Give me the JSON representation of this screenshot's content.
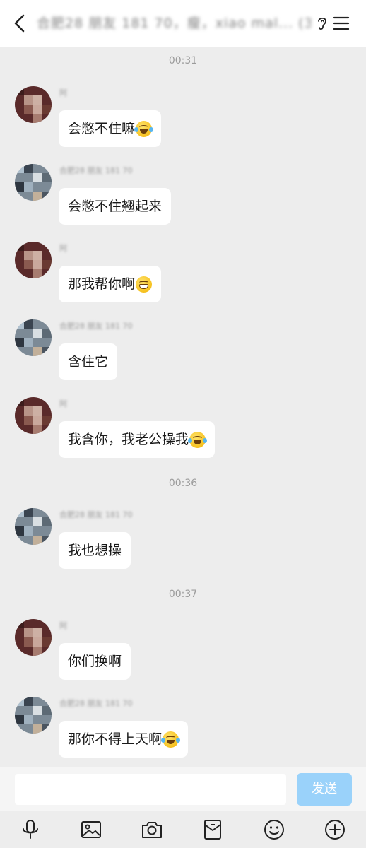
{
  "header": {
    "title": "合肥28 朋友 181 70，瘦，xiao mal... (3",
    "back_icon": "chevron-left-icon",
    "ear_icon": "ear-icon",
    "menu_icon": "hamburger-menu-icon"
  },
  "messages": [
    {
      "type": "timestamp",
      "text": "00:31"
    },
    {
      "sender": "阿",
      "text": "会憋不住嘛",
      "emoji": "tears-of-joy"
    },
    {
      "sender": "合肥28 朋友 181 70",
      "text": "会憋不住翘起来"
    },
    {
      "sender": "阿",
      "text": "那我帮你啊",
      "emoji": "grinning-teeth"
    },
    {
      "sender": "合肥28 朋友 181 70",
      "text": "含住它"
    },
    {
      "sender": "阿",
      "text": "我含你，我老公操我",
      "emoji": "tears-of-joy"
    },
    {
      "type": "timestamp",
      "text": "00:36"
    },
    {
      "sender": "合肥28 朋友 181 70",
      "text": "我也想操"
    },
    {
      "type": "timestamp",
      "text": "00:37"
    },
    {
      "sender": "阿",
      "text": "你们换啊"
    },
    {
      "sender": "合肥28 朋友 181 70",
      "text": "那你不得上天啊",
      "emoji": "tears-of-joy"
    }
  ],
  "composer": {
    "input_value": "",
    "send_label": "发送",
    "send_color": "#9AD2FA"
  },
  "toolbar": {
    "icons": [
      "microphone-icon",
      "image-icon",
      "camera-icon",
      "red-packet-icon",
      "emoji-icon",
      "plus-circle-icon"
    ]
  }
}
